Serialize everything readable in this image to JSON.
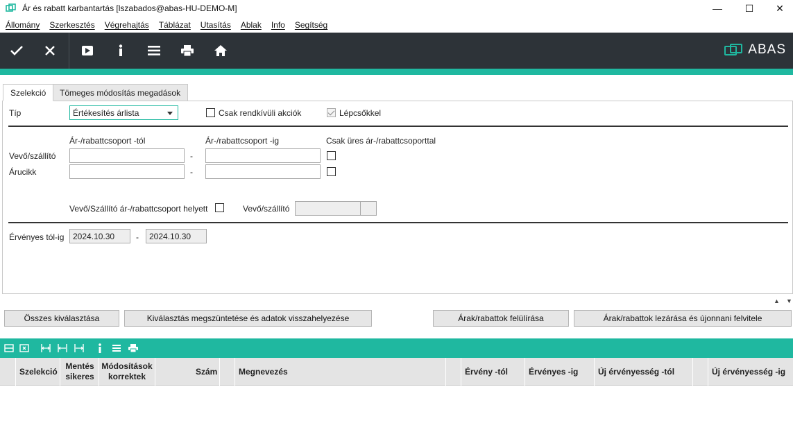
{
  "window": {
    "title": "Ár és rabatt karbantartás  [lszabados@abas-HU-DEMO-M]",
    "controls": [
      "—",
      "☐",
      "✕"
    ]
  },
  "menu": [
    "Állomány",
    "Szerkesztés",
    "Végrehajtás",
    "Táblázat",
    "Utasítás",
    "Ablak",
    "Info",
    "Segítség"
  ],
  "toolbar": {
    "logo_text": "ABAS",
    "accent": "#1fb8a0",
    "bg": "#2d3338"
  },
  "tabs": [
    "Szelekció",
    "Tömeges módosítás megadások"
  ],
  "form": {
    "tip_label": "Típ",
    "tip_value": "Értékesítés árlista",
    "csak_rendkivuli": "Csak rendkívüli akciók",
    "lepcsokkel": "Lépcsőkkel",
    "col_tol": "Ár-/rabattcsoport -tól",
    "col_ig": "Ár-/rabattcsoport -ig",
    "col_csak_ures": "Csak üres ár-/rabattcsoporttal",
    "row_vevo": "Vevő/szállító",
    "row_arucikk": "Árucikk",
    "dash": "-",
    "vevo_helyett": "Vevő/Szállító ár-/rabattcsoport helyett",
    "vevo_szallito": "Vevő/szállító",
    "ervenyes_label": "Érvényes tól-ig",
    "ervenyes_tol": "2024.10.30",
    "ervenyes_ig": "2024.10.30"
  },
  "buttons": {
    "osszes": "Összes kiválasztása",
    "megszuntetes": "Kiválasztás megszüntetése és adatok visszahelyezése",
    "felulirasa": "Árak/rabattok felülírása",
    "lezarasa": "Árak/rabattok lezárása és újonnani felvitele"
  },
  "grid": {
    "columns": [
      "Szelekció",
      "Mentés sikeres",
      "Módosítások korrektek",
      "Szám",
      "Megnevezés",
      "Érvény -tól",
      "Érvényes -ig",
      "Új érvényesség -tól",
      "Új érvényesség -ig"
    ]
  }
}
